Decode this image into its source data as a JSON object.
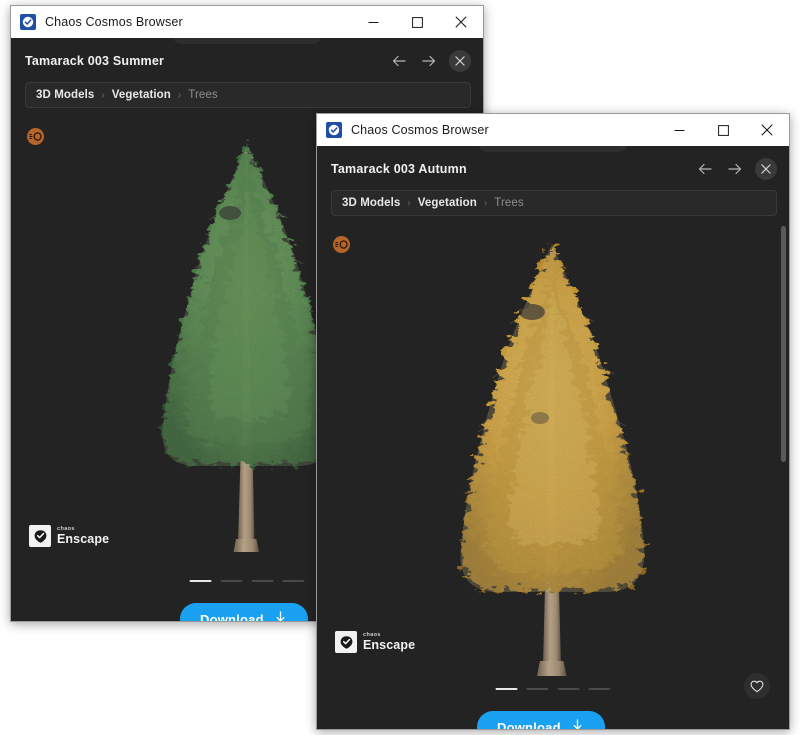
{
  "background_color": "#ffffff",
  "accent_color": "#1ba1f2",
  "windows": [
    {
      "id": "summer",
      "titlebar": {
        "app_icon": "chaos-logo-icon",
        "title": "Chaos Cosmos Browser",
        "minimize": "minimize-icon",
        "maximize": "maximize-icon",
        "close": "close-icon"
      },
      "detail": {
        "title": "Tamarack 003 Summer",
        "nav_back": "arrow-left-icon",
        "nav_forward": "arrow-right-icon",
        "nav_close": "close-icon"
      },
      "breadcrumb": [
        {
          "label": "3D Models",
          "active": true
        },
        {
          "label": "Vegetation",
          "active": true
        },
        {
          "label": "Trees",
          "active": false
        }
      ],
      "badge": "360-view-icon",
      "asset": {
        "type": "tree",
        "species": "Tamarack",
        "season": "Summer",
        "foliage_color": "#4a7a46",
        "foliage_color_dark": "#2e5430",
        "foliage_color_light": "#6d9a5c",
        "trunk_color": "#a89379"
      },
      "watermark": {
        "brand": "chaos",
        "product": "Enscape"
      },
      "carousel": {
        "count": 4,
        "active_index": 0
      },
      "download_label": "Download",
      "download_icon": "download-arrow-icon",
      "favorite": null,
      "scrollbar": false
    },
    {
      "id": "autumn",
      "titlebar": {
        "app_icon": "chaos-logo-icon",
        "title": "Chaos Cosmos Browser",
        "minimize": "minimize-icon",
        "maximize": "maximize-icon",
        "close": "close-icon"
      },
      "detail": {
        "title": "Tamarack 003 Autumn",
        "nav_back": "arrow-left-icon",
        "nav_forward": "arrow-right-icon",
        "nav_close": "close-icon"
      },
      "breadcrumb": [
        {
          "label": "3D Models",
          "active": true
        },
        {
          "label": "Vegetation",
          "active": true
        },
        {
          "label": "Trees",
          "active": false
        }
      ],
      "badge": "360-view-icon",
      "asset": {
        "type": "tree",
        "species": "Tamarack",
        "season": "Autumn",
        "foliage_color": "#c79733",
        "foliage_color_dark": "#9a7526",
        "foliage_color_light": "#dcb356",
        "trunk_color": "#a89379"
      },
      "watermark": {
        "brand": "chaos",
        "product": "Enscape"
      },
      "carousel": {
        "count": 4,
        "active_index": 0
      },
      "download_label": "Download",
      "download_icon": "download-arrow-icon",
      "favorite": "heart-icon",
      "scrollbar": true
    }
  ]
}
